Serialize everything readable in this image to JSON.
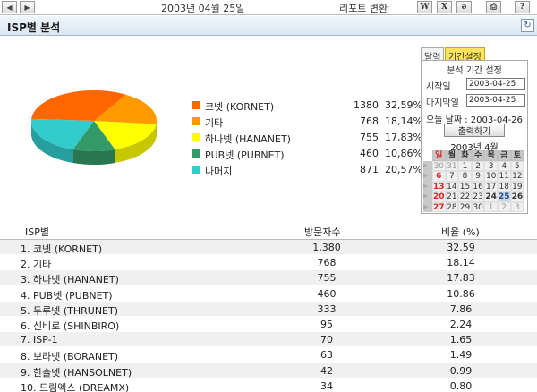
{
  "toolbar": {
    "date_title": "2003년 04월 25일",
    "report_label": "리포트 변환",
    "icons": [
      "back-icon",
      "forward-icon",
      "word-icon",
      "excel-icon",
      "hwp-icon",
      "print-icon",
      "help-icon"
    ],
    "help_label": "?"
  },
  "section": {
    "title": "ISP별 분석"
  },
  "legend": [
    {
      "name": "코넷 (KORNET)",
      "count": "1380",
      "pct": "32,59%",
      "color": "#ff6600"
    },
    {
      "name": "기타",
      "count": "768",
      "pct": "18,14%",
      "color": "#ff9900"
    },
    {
      "name": "하나넷 (HANANET)",
      "count": "755",
      "pct": "17,83%",
      "color": "#ffff00"
    },
    {
      "name": "PUB넷 (PUBNET)",
      "count": "460",
      "pct": "10,86%",
      "color": "#339966"
    },
    {
      "name": "나머지",
      "count": "871",
      "pct": "20,57%",
      "color": "#33cccc"
    }
  ],
  "chart_data": {
    "type": "pie",
    "categories": [
      "코넷 (KORNET)",
      "기타",
      "하나넷 (HANANET)",
      "PUB넷 (PUBNET)",
      "나머지"
    ],
    "values": [
      1380,
      768,
      755,
      460,
      871
    ],
    "colors": [
      "#ff6600",
      "#ff9900",
      "#ffff00",
      "#339966",
      "#33cccc"
    ]
  },
  "date_settings": {
    "tab_calendar": "달력",
    "tab_period": "기간설정",
    "title": "분석 기간 설정",
    "start_label": "시작일",
    "start_value": "2003-04-25",
    "end_label": "마지막일",
    "end_value": "2003-04-25",
    "today_text": "오늘 날짜 : 2003-04-26",
    "output_button": "출력하기",
    "month_title": "2003년 4월",
    "weekdays": [
      "일",
      "월",
      "화",
      "수",
      "목",
      "금",
      "토"
    ],
    "weeks": [
      [
        "30",
        "31",
        "1",
        "2",
        "3",
        "4",
        "5"
      ],
      [
        "6",
        "7",
        "8",
        "9",
        "10",
        "11",
        "12"
      ],
      [
        "13",
        "14",
        "15",
        "16",
        "17",
        "18",
        "19"
      ],
      [
        "20",
        "21",
        "22",
        "23",
        "24",
        "25",
        "26"
      ],
      [
        "27",
        "28",
        "29",
        "30",
        "1",
        "2",
        "3"
      ]
    ]
  },
  "table": {
    "headers": {
      "name": "ISP별",
      "count": "방문자수",
      "pct": "비율 (%)"
    },
    "rows": [
      {
        "name": "1. 코넷 (KORNET)",
        "count": "1,380",
        "pct": "32.59"
      },
      {
        "name": "2. 기타",
        "count": "768",
        "pct": "18.14"
      },
      {
        "name": "3. 하나넷 (HANANET)",
        "count": "755",
        "pct": "17.83"
      },
      {
        "name": "4. PUB넷 (PUBNET)",
        "count": "460",
        "pct": "10.86"
      },
      {
        "name": "5. 두루넷 (THRUNET)",
        "count": "333",
        "pct": "7.86"
      },
      {
        "name": "6. 신비로 (SHINBIRO)",
        "count": "95",
        "pct": "2.24"
      },
      {
        "name": "7. ISP-1",
        "count": "70",
        "pct": "1.65"
      },
      {
        "name": "8. 보라넷 (BORANET)",
        "count": "63",
        "pct": "1.49"
      },
      {
        "name": "9. 한솔넷 (HANSOLNET)",
        "count": "42",
        "pct": "0.99"
      },
      {
        "name": "10. 드림엑스 (DREAMX)",
        "count": "34",
        "pct": "0.80"
      }
    ]
  }
}
